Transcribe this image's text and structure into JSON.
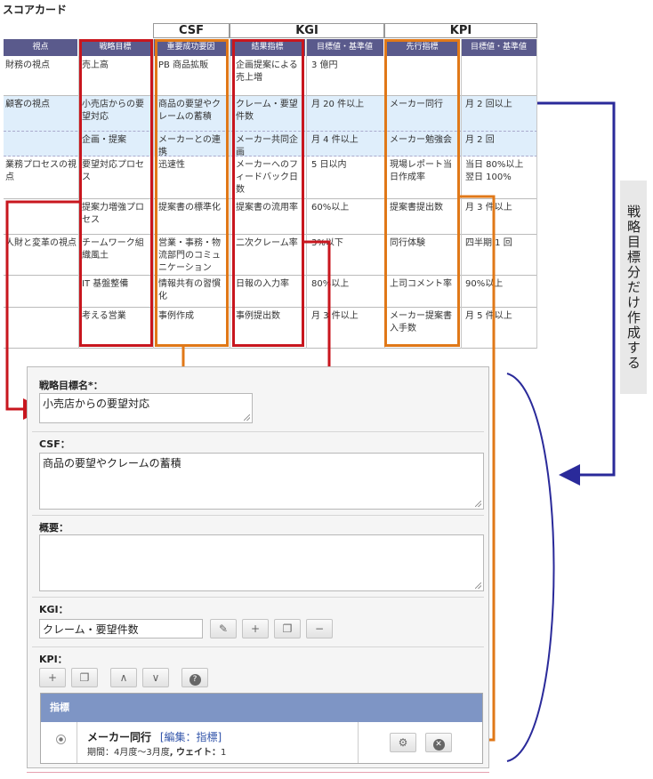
{
  "title": "スコアカード",
  "groups": [
    "CSF",
    "KGI",
    "KPI"
  ],
  "headers": [
    "視点",
    "戦略目標",
    "重要成功要因",
    "結果指標",
    "目標値・基準値",
    "先行指標",
    "目標値・基準値"
  ],
  "rows": [
    {
      "view": "財務の視点",
      "goal": "売上高",
      "csf": "PB 商品拡販",
      "kgi": "企画提案による売上増",
      "kgi_target": "3 億円",
      "kpi": "",
      "kpi_target": ""
    },
    {
      "view": "顧客の視点",
      "goal": "小売店からの要望対応",
      "csf": "商品の要望やクレームの蓄積",
      "kgi": "クレーム・要望件数",
      "kgi_target": "月 20 件以上",
      "kpi": "メーカー同行",
      "kpi_target": "月 2 回以上"
    },
    {
      "view": "",
      "goal": "企画・提案",
      "csf": "メーカーとの連携",
      "kgi": "メーカー共同企画",
      "kgi_target": "月 4 件以上",
      "kpi": "メーカー勉強会",
      "kpi_target": "月 2 回"
    },
    {
      "view": "業務プロセスの視点",
      "goal": "要望対応プロセス",
      "csf": "迅速性",
      "kgi": "メーカーへのフィードバック日数",
      "kgi_target": "5 日以内",
      "kpi": "現場レポート当日作成率",
      "kpi_target": "当日 80%以上 翌日 100%"
    },
    {
      "view": "",
      "goal": "提案力増強プロセス",
      "csf": "提案書の標準化",
      "kgi": "提案書の流用率",
      "kgi_target": "60%以上",
      "kpi": "提案書提出数",
      "kpi_target": "月 3 件以上"
    },
    {
      "view": "人財と変革の視点",
      "goal": "チームワーク組織風土",
      "csf": "営業・事務・物流部門のコミュニケーション",
      "kgi": "二次クレーム率",
      "kgi_target": "3%以下",
      "kpi": "同行体験",
      "kpi_target": "四半期 1 回"
    },
    {
      "view": "",
      "goal": "IT 基盤整備",
      "csf": "情報共有の習慣化",
      "kgi": "日報の入力率",
      "kgi_target": "80%以上",
      "kpi": "上司コメント率",
      "kpi_target": "90%以上"
    },
    {
      "view": "",
      "goal": "考える営業",
      "csf": "事例作成",
      "kgi": "事例提出数",
      "kgi_target": "月 3 件以上",
      "kpi": "メーカー提案書入手数",
      "kpi_target": "月 5 件以上"
    }
  ],
  "form": {
    "goal_label": "戦略目標名*：",
    "goal_value": "小売店からの要望対応",
    "csf_label": "CSF：",
    "csf_value": "商品の要望やクレームの蓄積",
    "summary_label": "概要：",
    "summary_value": "",
    "kgi_label": "KGI：",
    "kgi_value": "クレーム・要望件数",
    "kpi_label": "KPI：",
    "kpi_table_header": "指標",
    "kpi_item_name": "メーカー同行",
    "kpi_item_links": "[編集：指標]",
    "kpi_item_period_label": "期間：",
    "kpi_item_period": "4月度～3月度",
    "kpi_item_weight_label": ", ウェイト：",
    "kpi_item_weight": "1"
  },
  "side_note": "戦略目標分だけ作成する",
  "colors": {
    "red": "#c8161e",
    "orange": "#e07818",
    "blue": "#2a2a9a",
    "header": "#5a5a8c",
    "shade": "#dfeefb"
  }
}
